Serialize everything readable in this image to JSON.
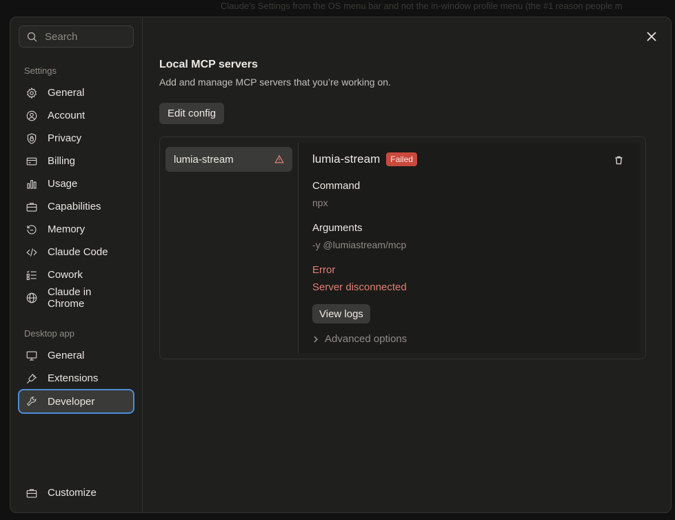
{
  "background_text": "Claude's Settings from the OS menu bar and not the in-window profile menu (the #1 reason people m",
  "search": {
    "placeholder": "Search"
  },
  "sidebar": {
    "settings_label": "Settings",
    "settings_items": [
      {
        "label": "General",
        "icon": "gear-icon"
      },
      {
        "label": "Account",
        "icon": "user-circle-icon"
      },
      {
        "label": "Privacy",
        "icon": "lock-shield-icon"
      },
      {
        "label": "Billing",
        "icon": "credit-card-icon"
      },
      {
        "label": "Usage",
        "icon": "bar-chart-icon"
      },
      {
        "label": "Capabilities",
        "icon": "briefcase-icon"
      },
      {
        "label": "Memory",
        "icon": "history-icon"
      },
      {
        "label": "Claude Code",
        "icon": "code-icon"
      },
      {
        "label": "Cowork",
        "icon": "checklist-icon"
      },
      {
        "label": "Claude in Chrome",
        "icon": "globe-icon"
      }
    ],
    "desktop_label": "Desktop app",
    "desktop_items": [
      {
        "label": "General",
        "icon": "monitor-icon"
      },
      {
        "label": "Extensions",
        "icon": "plug-icon"
      },
      {
        "label": "Developer",
        "icon": "wrench-icon",
        "active": true
      }
    ],
    "bottom_item": {
      "label": "Customize",
      "icon": "briefcase-icon"
    }
  },
  "main": {
    "title": "Local MCP servers",
    "subtitle": "Add and manage MCP servers that you’re working on.",
    "edit_config_label": "Edit config",
    "servers": [
      {
        "name": "lumia-stream",
        "status_icon": "warning-triangle-icon"
      }
    ],
    "detail": {
      "name": "lumia-stream",
      "status": "Failed",
      "command_label": "Command",
      "command_value": "npx",
      "arguments_label": "Arguments",
      "arguments_value": "-y @lumiastream/mcp",
      "error_label": "Error",
      "error_value": "Server disconnected",
      "view_logs_label": "View logs",
      "advanced_label": "Advanced options"
    }
  },
  "colors": {
    "accent_focus": "#4a8fd8",
    "failed_badge": "#c9493c",
    "error_text": "#e08070"
  }
}
